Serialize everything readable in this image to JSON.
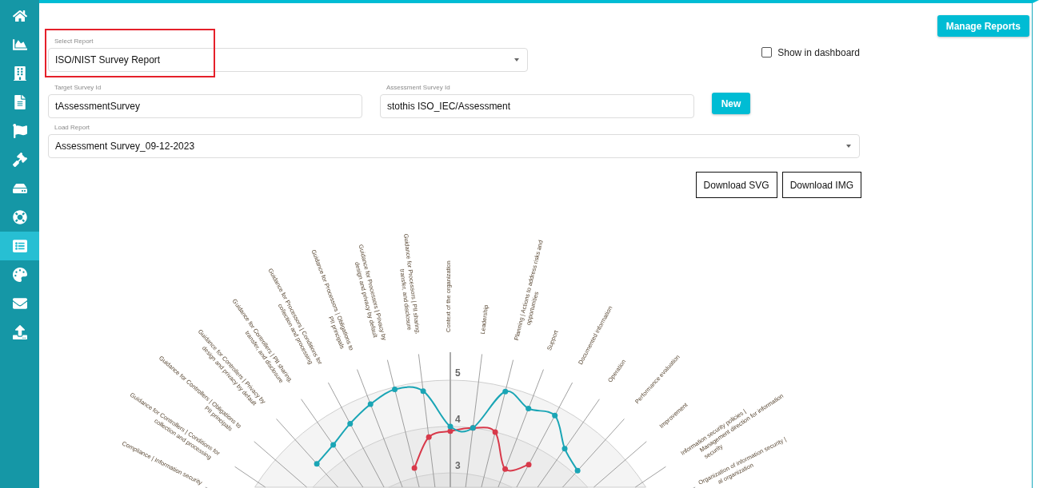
{
  "sidebar": {
    "items": [
      {
        "kind": "home",
        "selected": false
      },
      {
        "kind": "chart",
        "selected": false
      },
      {
        "kind": "building",
        "selected": false
      },
      {
        "kind": "document",
        "selected": false
      },
      {
        "kind": "flag",
        "selected": false
      },
      {
        "kind": "gavel",
        "selected": false
      },
      {
        "kind": "drive",
        "selected": false
      },
      {
        "kind": "lifebuoy",
        "selected": false
      },
      {
        "kind": "list",
        "selected": true
      },
      {
        "kind": "palette",
        "selected": false
      },
      {
        "kind": "mail",
        "selected": false
      },
      {
        "kind": "upload",
        "selected": false
      }
    ]
  },
  "header": {
    "button": "Manage Reports"
  },
  "form": {
    "select_report": {
      "label": "Select Report",
      "value": "ISO/NIST Survey Report"
    },
    "show_in_dashboard": {
      "label": "Show in dashboard",
      "checked": false
    },
    "target_survey_id": {
      "label": "Target Survey Id",
      "value": "tAssessmentSurvey"
    },
    "assessment_survey_id": {
      "label": "Assessment Survey Id",
      "value": "stothis ISO_IEC/Assessment"
    },
    "new_button": "New",
    "load_report": {
      "label": "Load Report",
      "value": "Assessment Survey_09-12-2023"
    },
    "download_buttons": [
      "Download SVG",
      "Download IMG"
    ]
  },
  "radar": {
    "ticks": [
      "5",
      "4",
      "3"
    ],
    "axes": [
      {
        "kind": "left",
        "lines": [
          "Compliance | Information security"
        ]
      },
      {
        "kind": "left",
        "lines": [
          "Guidance for Controllers | Conditions for",
          "collection and processing"
        ]
      },
      {
        "kind": "left",
        "lines": [
          "Guidance for Controllers | Obligations to",
          "PII principals"
        ]
      },
      {
        "kind": "left",
        "lines": [
          "Guidance for Controllers | Privacy by",
          "design and privacy by default"
        ]
      },
      {
        "kind": "left",
        "lines": [
          "Guidance for Controllers | PII sharing,",
          "transfer, and disclosure"
        ]
      },
      {
        "kind": "left",
        "lines": [
          "Guidance for Processors | Conditions for",
          "collection and processing"
        ]
      },
      {
        "kind": "left",
        "lines": [
          "Guidance for Processors | Obligations to",
          "PII principals"
        ]
      },
      {
        "kind": "left",
        "lines": [
          "Guidance for Processors | Privacy by",
          "design and privacy by default"
        ]
      },
      {
        "kind": "left",
        "lines": [
          "Guidance for Processors | PII sharing,",
          "transfer, and disclosure"
        ]
      },
      {
        "kind": "right",
        "lines": [
          "Context of the organization"
        ]
      },
      {
        "kind": "right",
        "lines": [
          "Leadership"
        ]
      },
      {
        "kind": "right",
        "lines": [
          "Planning | Actions to address risks and",
          "opportunities"
        ]
      },
      {
        "kind": "right",
        "lines": [
          "Support"
        ]
      },
      {
        "kind": "right",
        "lines": [
          "Documented information"
        ]
      },
      {
        "kind": "right",
        "lines": [
          "Operation"
        ]
      },
      {
        "kind": "right",
        "lines": [
          "Performance evaluation"
        ]
      },
      {
        "kind": "right",
        "lines": [
          "Improvement"
        ]
      },
      {
        "kind": "right",
        "lines": [
          "Information security policies |",
          "Management direction for information",
          "security"
        ]
      },
      {
        "kind": "right",
        "lines": [
          "Organization of information security |",
          "al organization"
        ]
      }
    ]
  }
}
